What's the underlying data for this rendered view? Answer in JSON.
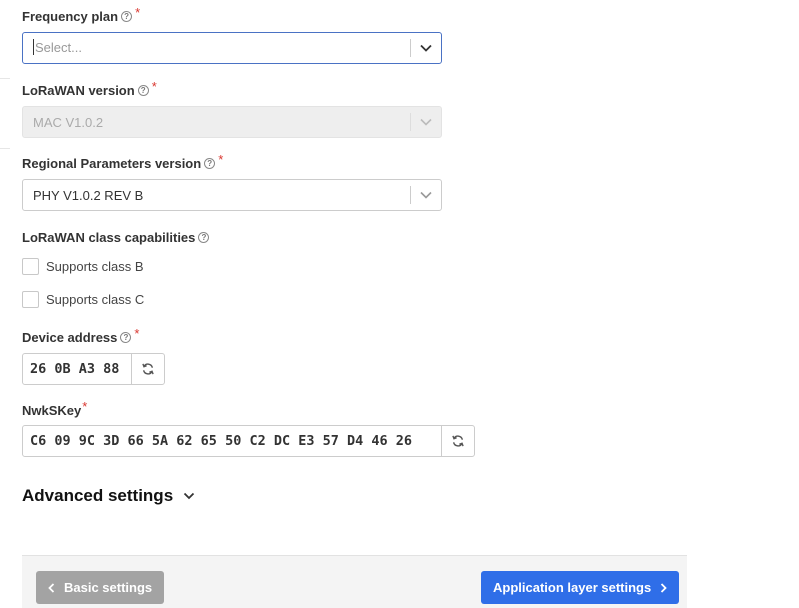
{
  "form": {
    "frequency_plan": {
      "label": "Frequency plan",
      "required": "*",
      "placeholder": "Select..."
    },
    "lorawan_version": {
      "label": "LoRaWAN version",
      "required": "*",
      "value": "MAC V1.0.2"
    },
    "regional_params": {
      "label": "Regional Parameters version",
      "required": "*",
      "value": "PHY V1.0.2 REV B"
    },
    "class_caps": {
      "label": "LoRaWAN class capabilities",
      "options": [
        {
          "label": "Supports class B",
          "checked": false
        },
        {
          "label": "Supports class C",
          "checked": false
        }
      ]
    },
    "device_address": {
      "label": "Device address",
      "required": "*",
      "value": "26 0B A3 88"
    },
    "nwkskey": {
      "label": "NwkSKey",
      "required": "*",
      "value": "C6 09 9C 3D 66 5A 62 65 50 C2 DC E3 57 D4 46 26"
    }
  },
  "advanced": {
    "title": "Advanced settings"
  },
  "footer": {
    "back_label": "Basic settings",
    "next_label": "Application layer settings"
  },
  "colors": {
    "primary": "#2f6ee8",
    "secondary_button": "#a3a3a3",
    "required": "#d9362f",
    "focus_border": "#4a72c4"
  },
  "icons": {
    "help": "question-circle-icon",
    "dropdown": "chevron-down-icon",
    "regenerate": "refresh-icon",
    "back": "chevron-left-icon",
    "next": "chevron-right-icon"
  }
}
